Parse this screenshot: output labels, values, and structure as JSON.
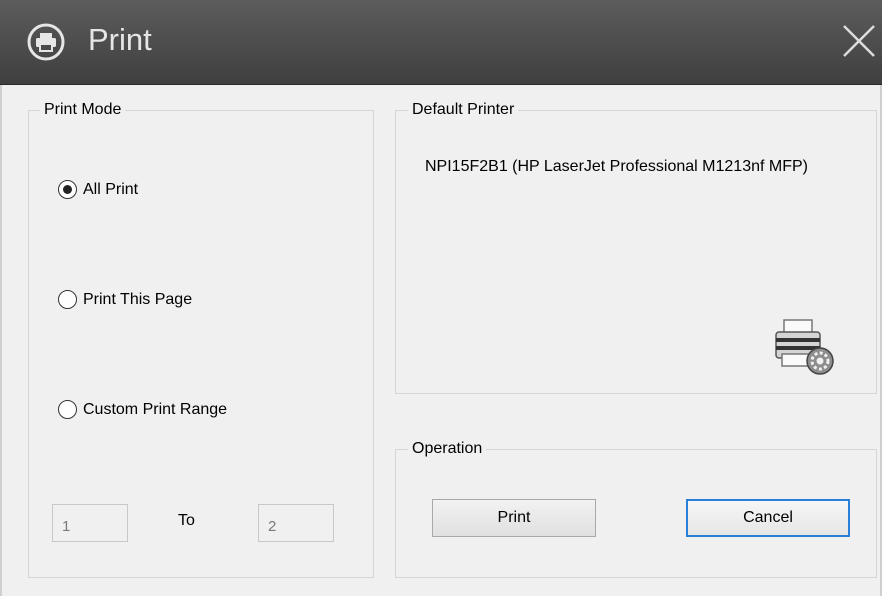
{
  "window": {
    "title": "Print",
    "title_icon": "printer-icon",
    "close_icon": "close-icon"
  },
  "print_mode": {
    "label": "Print Mode",
    "options": [
      {
        "label": "All Print",
        "selected": true
      },
      {
        "label": "Print This Page",
        "selected": false
      },
      {
        "label": "Custom Print Range",
        "selected": false
      }
    ],
    "range_from": "1",
    "range_to_label": "To",
    "range_to": "2"
  },
  "default_printer": {
    "label": "Default Printer",
    "name": "NPI15F2B1 (HP LaserJet Professional M1213nf MFP)",
    "settings_icon": "printer-settings-icon"
  },
  "operation": {
    "label": "Operation",
    "print_button": "Print",
    "cancel_button": "Cancel"
  },
  "colors": {
    "titlebar": "#4a4a4a",
    "default_button_border": "#2a7fd6"
  }
}
